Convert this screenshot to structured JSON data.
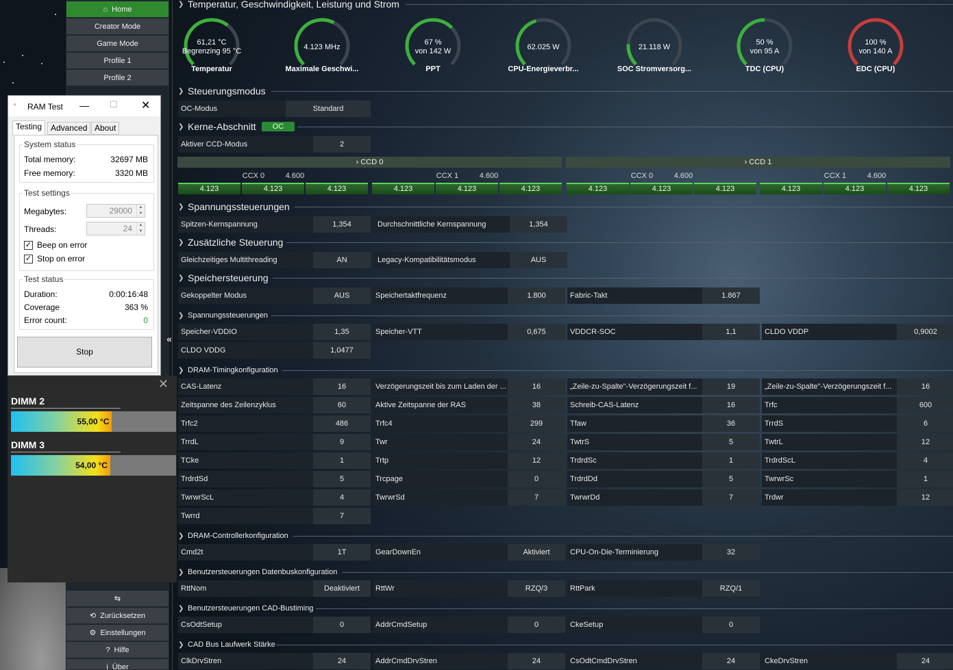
{
  "sidebar": {
    "home": "Home",
    "creator": "Creator Mode",
    "game": "Game Mode",
    "profile1": "Profile 1",
    "profile2": "Profile 2",
    "reset": "Zurücksetzen",
    "settings": "Einstellungen",
    "help": "Hilfe",
    "about": "Über"
  },
  "sections": {
    "temperatur": "Temperatur, Geschwindigkeit, Leistung und Strom",
    "steuerung": "Steuerungsmodus",
    "kerne": "Kerne-Abschnitt",
    "kerne_badge": "OC",
    "spannung": "Spannungssteuerungen",
    "zusatz": "Zusätzliche Steuerung",
    "speicher": "Speichersteuerung",
    "speicher_spannung": "Spannungssteuerungen",
    "dram_timing": "DRAM-Timingkonfiguration",
    "dram_ctrl": "DRAM-Controllerkonfiguration",
    "datenbus": "Benutzersteuerungen Datenbuskonfiguration",
    "cad": "Benutzersteuerungen CAD-Bustiming",
    "cadbus": "CAD Bus Laufwerk Stärke"
  },
  "gauges": [
    {
      "v1": "61,21 °C",
      "v2": "Begrenzing 95 °C",
      "label": "Temperatur",
      "pct": 0.64,
      "color": "#3db03d"
    },
    {
      "v1": "4.123  MHz",
      "v2": "",
      "label": "Maximale Geschwi...",
      "pct": 0.6,
      "color": "#3db03d"
    },
    {
      "v1": "67 %",
      "v2": "von 142 W",
      "label": "PPT",
      "pct": 0.67,
      "color": "#3db03d"
    },
    {
      "v1": "62.025 W",
      "v2": "",
      "label": "CPU-Energieverbr...",
      "pct": 0.44,
      "color": "#3db03d"
    },
    {
      "v1": "21.118 W",
      "v2": "",
      "label": "SOC Stromversorg...",
      "pct": 0.18,
      "color": "#3db03d"
    },
    {
      "v1": "50 %",
      "v2": "von 95 A",
      "label": "TDC (CPU)",
      "pct": 0.5,
      "color": "#3db03d"
    },
    {
      "v1": "100 %",
      "v2": "von 140 A",
      "label": "EDC (CPU)",
      "pct": 1.0,
      "color": "#c83c3c"
    }
  ],
  "oc_mode": {
    "label": "OC-Modus",
    "value": "Standard"
  },
  "ccd_mode": {
    "label": "Aktiver CCD-Modus",
    "value": "2"
  },
  "ccd": {
    "ccd0": "CCD 0",
    "ccd1": "CCD 1",
    "ccx0": "CCX 0",
    "ccx1": "CCX 1",
    "ccx_freq": "4.600",
    "core_freq": "4.123"
  },
  "voltage": [
    {
      "label": "Spitzen-Kernspannung",
      "value": "1,354"
    },
    {
      "label": "Durchschnittliche Kernspannung",
      "value": "1,354"
    }
  ],
  "extra": [
    {
      "label": "Gleichzeitiges Multithreading",
      "value": "AN"
    },
    {
      "label": "Legacy-Kompatibilitätsmodus",
      "value": "AUS"
    }
  ],
  "memory": [
    {
      "label": "Gekoppelter Modus",
      "value": "AUS"
    },
    {
      "label": "Speichertaktfrequenz",
      "value": "1.800"
    },
    {
      "label": "Fabric-Takt",
      "value": "1.867"
    }
  ],
  "mem_voltage": [
    {
      "label": "Speicher-VDDIO",
      "value": "1,35"
    },
    {
      "label": "Speicher-VTT",
      "value": "0,675"
    },
    {
      "label": "VDDCR-SOC",
      "value": "1,1"
    },
    {
      "label": "CLDO VDDP",
      "value": "0,9002"
    },
    {
      "label": "CLDO VDDG",
      "value": "1,0477"
    }
  ],
  "timings": [
    {
      "label": "CAS-Latenz",
      "value": "16"
    },
    {
      "label": "Verzögerungszeit bis zum Laden der ...",
      "value": "16"
    },
    {
      "label": "„Zeile-zu-Spalte\"-Verzögerungszeit f...",
      "value": "19"
    },
    {
      "label": "„Zeile-zu-Spalte\"-Verzögerungszeit f...",
      "value": "16"
    },
    {
      "label": "Zeitspanne des Zeilenzyklus",
      "value": "60"
    },
    {
      "label": "Aktive Zeitspanne der RAS",
      "value": "38"
    },
    {
      "label": "Schreib-CAS-Latenz",
      "value": "16"
    },
    {
      "label": "Trfc",
      "value": "600"
    },
    {
      "label": "Trfc2",
      "value": "486"
    },
    {
      "label": "Trfc4",
      "value": "299"
    },
    {
      "label": "Tfaw",
      "value": "36"
    },
    {
      "label": "TrrdS",
      "value": "6"
    },
    {
      "label": "TrrdL",
      "value": "9"
    },
    {
      "label": "Twr",
      "value": "24"
    },
    {
      "label": "TwtrS",
      "value": "5"
    },
    {
      "label": "TwtrL",
      "value": "12"
    },
    {
      "label": "TCke",
      "value": "1"
    },
    {
      "label": "Trtp",
      "value": "12"
    },
    {
      "label": "TrdrdSc",
      "value": "1"
    },
    {
      "label": "TrdrdScL",
      "value": "4"
    },
    {
      "label": "TrdrdSd",
      "value": "5"
    },
    {
      "label": "Trcpage",
      "value": "0"
    },
    {
      "label": "TrdrdDd",
      "value": "5"
    },
    {
      "label": "TwrwrSc",
      "value": "1"
    },
    {
      "label": "TwrwrScL",
      "value": "4"
    },
    {
      "label": "TwrwrSd",
      "value": "7"
    },
    {
      "label": "TwrwrDd",
      "value": "7"
    },
    {
      "label": "Trdwr",
      "value": "12"
    },
    {
      "label": "Twrrd",
      "value": "7"
    }
  ],
  "ctrl": [
    {
      "label": "Cmd2t",
      "value": "1T"
    },
    {
      "label": "GearDownEn",
      "value": "Aktiviert"
    },
    {
      "label": "CPU-On-Die-Terminierung",
      "value": "32"
    }
  ],
  "databus": [
    {
      "label": "RttNom",
      "value": "Deaktiviert"
    },
    {
      "label": "RttWr",
      "value": "RZQ/3"
    },
    {
      "label": "RttPark",
      "value": "RZQ/1"
    }
  ],
  "cadtiming": [
    {
      "label": "CsOdtSetup",
      "value": "0"
    },
    {
      "label": "AddrCmdSetup",
      "value": "0"
    },
    {
      "label": "CkeSetup",
      "value": "0"
    }
  ],
  "cadstrength": [
    {
      "label": "ClkDrvStren",
      "value": "24"
    },
    {
      "label": "AddrCmdDrvStren",
      "value": "24"
    },
    {
      "label": "CsOdtCmdDrvStren",
      "value": "24"
    },
    {
      "label": "CkeDrvStren",
      "value": "24"
    }
  ],
  "ramtest": {
    "title": "RAM Test",
    "tabs": [
      "Testing",
      "Advanced",
      "About"
    ],
    "system_status": "System status",
    "total_label": "Total memory:",
    "total": "32697 MB",
    "free_label": "Free memory:",
    "free": "3320 MB",
    "test_settings": "Test settings",
    "mb_label": "Megabytes:",
    "mb": "29000",
    "threads_label": "Threads:",
    "threads": "24",
    "beep": "Beep on error",
    "stoperr": "Stop on error",
    "test_status": "Test status",
    "dur_label": "Duration:",
    "dur": "0:00:16:48",
    "cov_label": "Coverage",
    "cov": "363 %",
    "err_label": "Error count:",
    "err": "0",
    "stop": "Stop"
  },
  "dimms": [
    {
      "name": "DIMM 2",
      "value": "55,00 °C",
      "level": 0.55
    },
    {
      "name": "DIMM 3",
      "value": "54,00 °C",
      "level": 0.54
    }
  ],
  "colors": {
    "accent": "#2f8a2f",
    "edc": "#c83c3c"
  }
}
